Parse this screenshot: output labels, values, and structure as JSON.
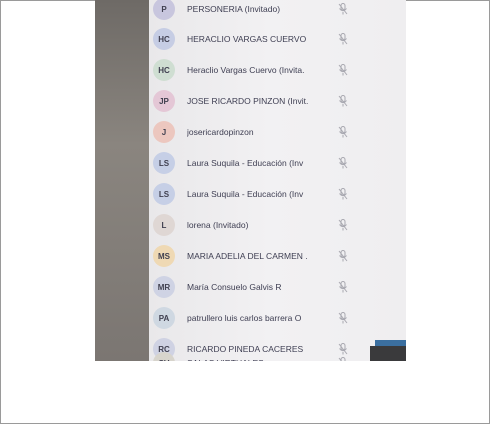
{
  "participants": [
    {
      "initials": "P",
      "name": "PERSONERIA (Invitado)",
      "avatar_color": "#c8c6de"
    },
    {
      "initials": "HC",
      "name": "HERACLIO VARGAS CUERVO",
      "avatar_color": "#c6cde4"
    },
    {
      "initials": "HC",
      "name": "Heraclio Vargas Cuervo (Invita.",
      "avatar_color": "#cfded2"
    },
    {
      "initials": "JP",
      "name": "JOSE RICARDO PINZON (Invit.",
      "avatar_color": "#e4c7d6"
    },
    {
      "initials": "J",
      "name": "josericardopinzon",
      "avatar_color": "#ecc7bf"
    },
    {
      "initials": "LS",
      "name": "Laura Suquila - Educación (Inv",
      "avatar_color": "#c6cfe6"
    },
    {
      "initials": "LS",
      "name": "Laura Suquila - Educación (Inv",
      "avatar_color": "#c6cfe6"
    },
    {
      "initials": "L",
      "name": "lorena (Invitado)",
      "avatar_color": "#dfd7d4"
    },
    {
      "initials": "MS",
      "name": "MARIA ADELIA DEL CARMEN .",
      "avatar_color": "#efd9b4"
    },
    {
      "initials": "MR",
      "name": "María Consuelo Galvis R",
      "avatar_color": "#cfd3e4"
    },
    {
      "initials": "PA",
      "name": "patrullero luis carlos barrera O",
      "avatar_color": "#cfd8e2"
    },
    {
      "initials": "RC",
      "name": "RICARDO PINEDA CACERES",
      "avatar_color": "#cfd2e3"
    },
    {
      "initials": "SV",
      "name": "SALAS VIRTUALES",
      "avatar_color": "#d7d4cc"
    }
  ],
  "icons": {
    "mic": "mic-muted-icon"
  },
  "colors": {
    "panel_bg": "#efeef0",
    "text": "#3e3e52",
    "mic": "#a8a8b0"
  }
}
